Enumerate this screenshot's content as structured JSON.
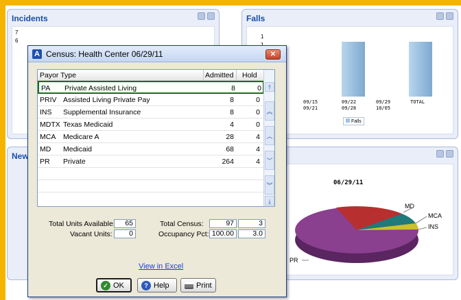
{
  "background_panels": {
    "incidents": {
      "title": "Incidents",
      "y_ticks": [
        "7",
        "6"
      ]
    },
    "falls": {
      "title": "Falls",
      "y_ticks": [
        "1",
        "1",
        "1"
      ],
      "x_labels": [
        {
          "line1": "09/15",
          "line2": "09/21"
        },
        {
          "line1": "09/22",
          "line2": "09/28"
        },
        {
          "line1": "09/29",
          "line2": "10/05"
        },
        {
          "line1": "TOTAL",
          "line2": ""
        }
      ],
      "legend": "Falls",
      "bar_color": "#9ec4e4"
    },
    "new": {
      "title": "New"
    },
    "census_chart": {
      "date": "06/29/11",
      "labels": {
        "md": "MD",
        "mca": "MCA",
        "ins": "INS",
        "pr": "PR"
      },
      "colors": {
        "pr": "#8a3f8f",
        "md": "#b82f2f",
        "mca": "#1f7a7a",
        "ins": "#c9c22c"
      }
    }
  },
  "dialog": {
    "title": "Census:  Health Center 06/29/11",
    "grid": {
      "headers": {
        "payor": "Payor Type",
        "admitted": "Admitted",
        "hold": "Hold"
      },
      "rows": [
        {
          "code": "PA",
          "name": "Private Assisted Living",
          "admitted": "8",
          "hold": "0"
        },
        {
          "code": "PRIV",
          "name": "Assisted Living Private Pay",
          "admitted": "8",
          "hold": "0"
        },
        {
          "code": "INS",
          "name": "Supplemental Insurance",
          "admitted": "8",
          "hold": "0"
        },
        {
          "code": "MDTX",
          "name": "Texas Medicaid",
          "admitted": "4",
          "hold": "0"
        },
        {
          "code": "MCA",
          "name": "Medicare A",
          "admitted": "28",
          "hold": "4"
        },
        {
          "code": "MD",
          "name": "Medicaid",
          "admitted": "68",
          "hold": "4"
        },
        {
          "code": "PR",
          "name": "Private",
          "admitted": "264",
          "hold": "4"
        }
      ]
    },
    "totals": {
      "units_available_label": "Total Units Available:",
      "units_available": "65",
      "vacant_units_label": "Vacant Units:",
      "vacant_units": "0",
      "total_census_label": "Total Census:",
      "total_census": "97",
      "total_census_hold": "3",
      "occupancy_label": "Occupancy Pct:",
      "occupancy": "100.00",
      "occupancy_hold": "3.0"
    },
    "link": "View in Excel",
    "buttons": {
      "ok": "OK",
      "help": "Help",
      "print": "Print"
    }
  }
}
